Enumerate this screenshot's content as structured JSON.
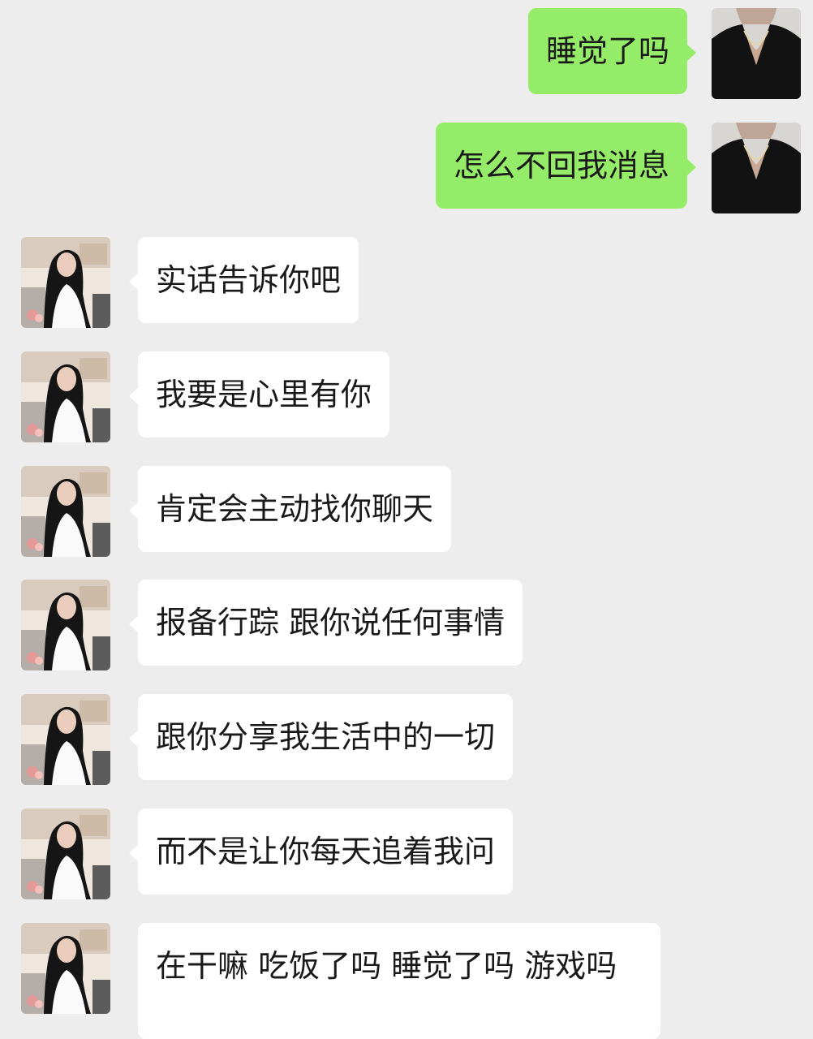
{
  "chat": {
    "messages": [
      {
        "sender": "me",
        "text": "睡觉了吗"
      },
      {
        "sender": "me",
        "text": "怎么不回我消息"
      },
      {
        "sender": "them",
        "text": "实话告诉你吧"
      },
      {
        "sender": "them",
        "text": "我要是心里有你"
      },
      {
        "sender": "them",
        "text": "肯定会主动找你聊天"
      },
      {
        "sender": "them",
        "text": "报备行踪 跟你说任何事情"
      },
      {
        "sender": "them",
        "text": "跟你分享我生活中的一切"
      },
      {
        "sender": "them",
        "text": "而不是让你每天追着我问"
      },
      {
        "sender": "them",
        "text": "在干嘛 吃饭了吗 睡觉了吗 游戏吗"
      }
    ]
  },
  "colors": {
    "background": "#ededed",
    "my_bubble": "#95ec69",
    "their_bubble": "#ffffff"
  },
  "icons": {
    "my_avatar": "avatar-dark-clothing",
    "their_avatar": "avatar-woman-portrait"
  }
}
